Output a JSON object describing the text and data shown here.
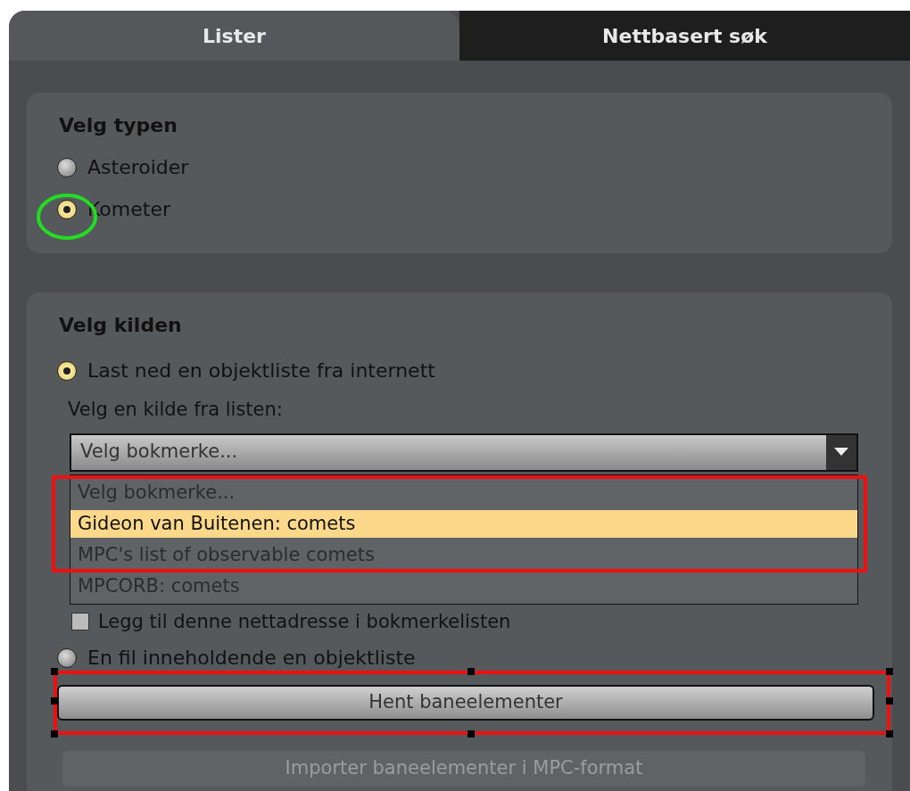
{
  "tabs": [
    {
      "label": "Lister",
      "selected": true
    },
    {
      "label": "Nettbasert søk",
      "selected": false
    }
  ],
  "type_group": {
    "title": "Velg typen",
    "options": [
      {
        "label": "Asteroider",
        "selected": false
      },
      {
        "label": "Kometer",
        "selected": true
      }
    ]
  },
  "source_group": {
    "title": "Velg kilden",
    "download_option": {
      "label": "Last ned en objektliste fra internett",
      "selected": true
    },
    "list_label": "Velg en kilde fra listen:",
    "dropdown": {
      "value": "Velg bokmerke...",
      "expanded": true,
      "items": [
        {
          "label": "Velg bokmerke...",
          "highlighted": false
        },
        {
          "label": "Gideon van Buitenen: comets",
          "highlighted": true
        },
        {
          "label": "MPC's list of observable comets",
          "highlighted": false
        },
        {
          "label": "MPCORB: comets",
          "highlighted": false
        }
      ]
    },
    "bookmark_checkbox": {
      "label": "Legg til denne nettadresse i bokmerkelisten",
      "checked": false
    },
    "file_option": {
      "label": "En fil inneholdende en objektliste",
      "selected": false
    },
    "fetch_button": "Hent baneelementer",
    "import_button": "Importer baneelementer i MPC-format"
  },
  "annotations": [
    {
      "kind": "circle",
      "color": "#22dd22"
    },
    {
      "kind": "rectangle",
      "color": "#ee1111"
    },
    {
      "kind": "selection",
      "color": "#ee1111"
    }
  ]
}
